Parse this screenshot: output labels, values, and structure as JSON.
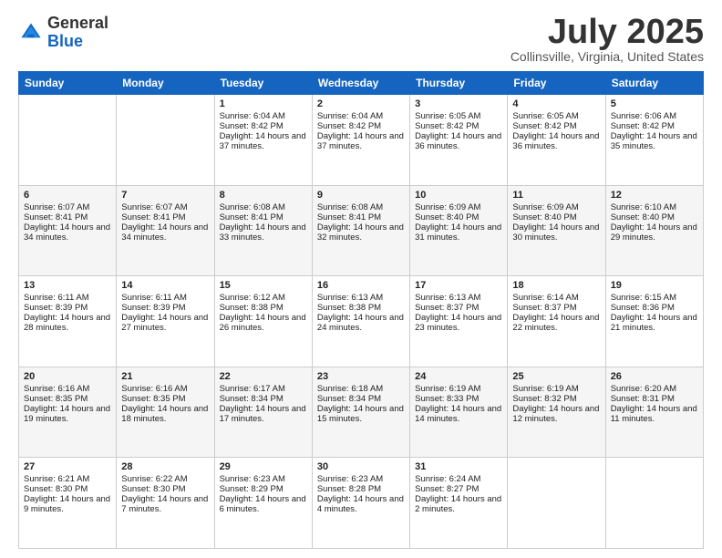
{
  "header": {
    "logo_general": "General",
    "logo_blue": "Blue",
    "month_title": "July 2025",
    "location": "Collinsville, Virginia, United States"
  },
  "days_of_week": [
    "Sunday",
    "Monday",
    "Tuesday",
    "Wednesday",
    "Thursday",
    "Friday",
    "Saturday"
  ],
  "weeks": [
    [
      {
        "day": "",
        "info": ""
      },
      {
        "day": "",
        "info": ""
      },
      {
        "day": "1",
        "info": "Sunrise: 6:04 AM\nSunset: 8:42 PM\nDaylight: 14 hours and 37 minutes."
      },
      {
        "day": "2",
        "info": "Sunrise: 6:04 AM\nSunset: 8:42 PM\nDaylight: 14 hours and 37 minutes."
      },
      {
        "day": "3",
        "info": "Sunrise: 6:05 AM\nSunset: 8:42 PM\nDaylight: 14 hours and 36 minutes."
      },
      {
        "day": "4",
        "info": "Sunrise: 6:05 AM\nSunset: 8:42 PM\nDaylight: 14 hours and 36 minutes."
      },
      {
        "day": "5",
        "info": "Sunrise: 6:06 AM\nSunset: 8:42 PM\nDaylight: 14 hours and 35 minutes."
      }
    ],
    [
      {
        "day": "6",
        "info": "Sunrise: 6:07 AM\nSunset: 8:41 PM\nDaylight: 14 hours and 34 minutes."
      },
      {
        "day": "7",
        "info": "Sunrise: 6:07 AM\nSunset: 8:41 PM\nDaylight: 14 hours and 34 minutes."
      },
      {
        "day": "8",
        "info": "Sunrise: 6:08 AM\nSunset: 8:41 PM\nDaylight: 14 hours and 33 minutes."
      },
      {
        "day": "9",
        "info": "Sunrise: 6:08 AM\nSunset: 8:41 PM\nDaylight: 14 hours and 32 minutes."
      },
      {
        "day": "10",
        "info": "Sunrise: 6:09 AM\nSunset: 8:40 PM\nDaylight: 14 hours and 31 minutes."
      },
      {
        "day": "11",
        "info": "Sunrise: 6:09 AM\nSunset: 8:40 PM\nDaylight: 14 hours and 30 minutes."
      },
      {
        "day": "12",
        "info": "Sunrise: 6:10 AM\nSunset: 8:40 PM\nDaylight: 14 hours and 29 minutes."
      }
    ],
    [
      {
        "day": "13",
        "info": "Sunrise: 6:11 AM\nSunset: 8:39 PM\nDaylight: 14 hours and 28 minutes."
      },
      {
        "day": "14",
        "info": "Sunrise: 6:11 AM\nSunset: 8:39 PM\nDaylight: 14 hours and 27 minutes."
      },
      {
        "day": "15",
        "info": "Sunrise: 6:12 AM\nSunset: 8:38 PM\nDaylight: 14 hours and 26 minutes."
      },
      {
        "day": "16",
        "info": "Sunrise: 6:13 AM\nSunset: 8:38 PM\nDaylight: 14 hours and 24 minutes."
      },
      {
        "day": "17",
        "info": "Sunrise: 6:13 AM\nSunset: 8:37 PM\nDaylight: 14 hours and 23 minutes."
      },
      {
        "day": "18",
        "info": "Sunrise: 6:14 AM\nSunset: 8:37 PM\nDaylight: 14 hours and 22 minutes."
      },
      {
        "day": "19",
        "info": "Sunrise: 6:15 AM\nSunset: 8:36 PM\nDaylight: 14 hours and 21 minutes."
      }
    ],
    [
      {
        "day": "20",
        "info": "Sunrise: 6:16 AM\nSunset: 8:35 PM\nDaylight: 14 hours and 19 minutes."
      },
      {
        "day": "21",
        "info": "Sunrise: 6:16 AM\nSunset: 8:35 PM\nDaylight: 14 hours and 18 minutes."
      },
      {
        "day": "22",
        "info": "Sunrise: 6:17 AM\nSunset: 8:34 PM\nDaylight: 14 hours and 17 minutes."
      },
      {
        "day": "23",
        "info": "Sunrise: 6:18 AM\nSunset: 8:34 PM\nDaylight: 14 hours and 15 minutes."
      },
      {
        "day": "24",
        "info": "Sunrise: 6:19 AM\nSunset: 8:33 PM\nDaylight: 14 hours and 14 minutes."
      },
      {
        "day": "25",
        "info": "Sunrise: 6:19 AM\nSunset: 8:32 PM\nDaylight: 14 hours and 12 minutes."
      },
      {
        "day": "26",
        "info": "Sunrise: 6:20 AM\nSunset: 8:31 PM\nDaylight: 14 hours and 11 minutes."
      }
    ],
    [
      {
        "day": "27",
        "info": "Sunrise: 6:21 AM\nSunset: 8:30 PM\nDaylight: 14 hours and 9 minutes."
      },
      {
        "day": "28",
        "info": "Sunrise: 6:22 AM\nSunset: 8:30 PM\nDaylight: 14 hours and 7 minutes."
      },
      {
        "day": "29",
        "info": "Sunrise: 6:23 AM\nSunset: 8:29 PM\nDaylight: 14 hours and 6 minutes."
      },
      {
        "day": "30",
        "info": "Sunrise: 6:23 AM\nSunset: 8:28 PM\nDaylight: 14 hours and 4 minutes."
      },
      {
        "day": "31",
        "info": "Sunrise: 6:24 AM\nSunset: 8:27 PM\nDaylight: 14 hours and 2 minutes."
      },
      {
        "day": "",
        "info": ""
      },
      {
        "day": "",
        "info": ""
      }
    ]
  ]
}
